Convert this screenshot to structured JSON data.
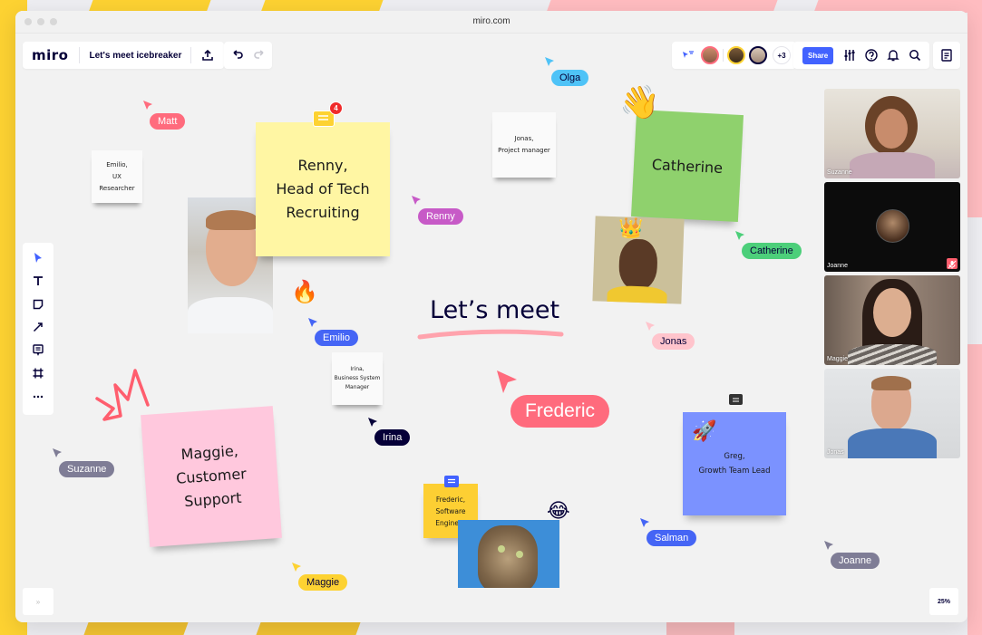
{
  "browser": {
    "url": "miro.com"
  },
  "header": {
    "logo": "miro",
    "board_name": "Let's meet icebreaker",
    "more_collaborators": "+3",
    "share_label": "Share"
  },
  "canvas": {
    "title": "Let’s meet",
    "zoom_level": "25%",
    "expand_label": "»",
    "stickies": [
      {
        "text": "Renny,\nHead of Tech\nRecruiting",
        "color": "#fff6a3"
      },
      {
        "text": "Catherine",
        "color": "#8fd16d"
      },
      {
        "text": "Maggie,\nCustomer\nSupport",
        "color": "#ffc8dd"
      },
      {
        "text": "Greg,\nGrowth Team Lead",
        "color": "#7b92ff"
      },
      {
        "text": "Frederic,\nSoftware\nEngineer",
        "color": "#fdcf33"
      }
    ],
    "cards": [
      {
        "text": "Emilio,\nUX\nResearcher"
      },
      {
        "text": "Jonas,\nProject manager"
      },
      {
        "text": "Irina,\nBusiness System\nManager"
      }
    ],
    "comment_badge_count": "4",
    "cursors": [
      {
        "name": "Matt",
        "color": "#ff6b7d"
      },
      {
        "name": "Olga",
        "color": "#4fc3f7"
      },
      {
        "name": "Renny",
        "color": "#c75ac7"
      },
      {
        "name": "Catherine",
        "color": "#4ccf7a"
      },
      {
        "name": "Emilio",
        "color": "#4565f5"
      },
      {
        "name": "Jonas",
        "color": "#ffc4cc"
      },
      {
        "name": "Frederic",
        "color": "#ff6b7d"
      },
      {
        "name": "Irina",
        "color": "#050038"
      },
      {
        "name": "Suzanne",
        "color": "#7f7d96"
      },
      {
        "name": "Salman",
        "color": "#4565f5"
      },
      {
        "name": "Joanne",
        "color": "#7f7d96"
      },
      {
        "name": "Maggie",
        "color": "#fdd232"
      }
    ],
    "emojis": {
      "fire": "🔥",
      "wave": "👋",
      "crown": "👑",
      "rocket": "🚀",
      "laugh": "😂"
    }
  },
  "video_call": {
    "participants": [
      {
        "name": "Suzanne",
        "muted": false
      },
      {
        "name": "Joanne",
        "muted": true
      },
      {
        "name": "Maggie",
        "muted": false
      },
      {
        "name": "Jonas",
        "muted": false
      }
    ]
  },
  "colors": {
    "accent": "#4262ff",
    "ink": "#050038",
    "background": "#f2f2f2"
  }
}
